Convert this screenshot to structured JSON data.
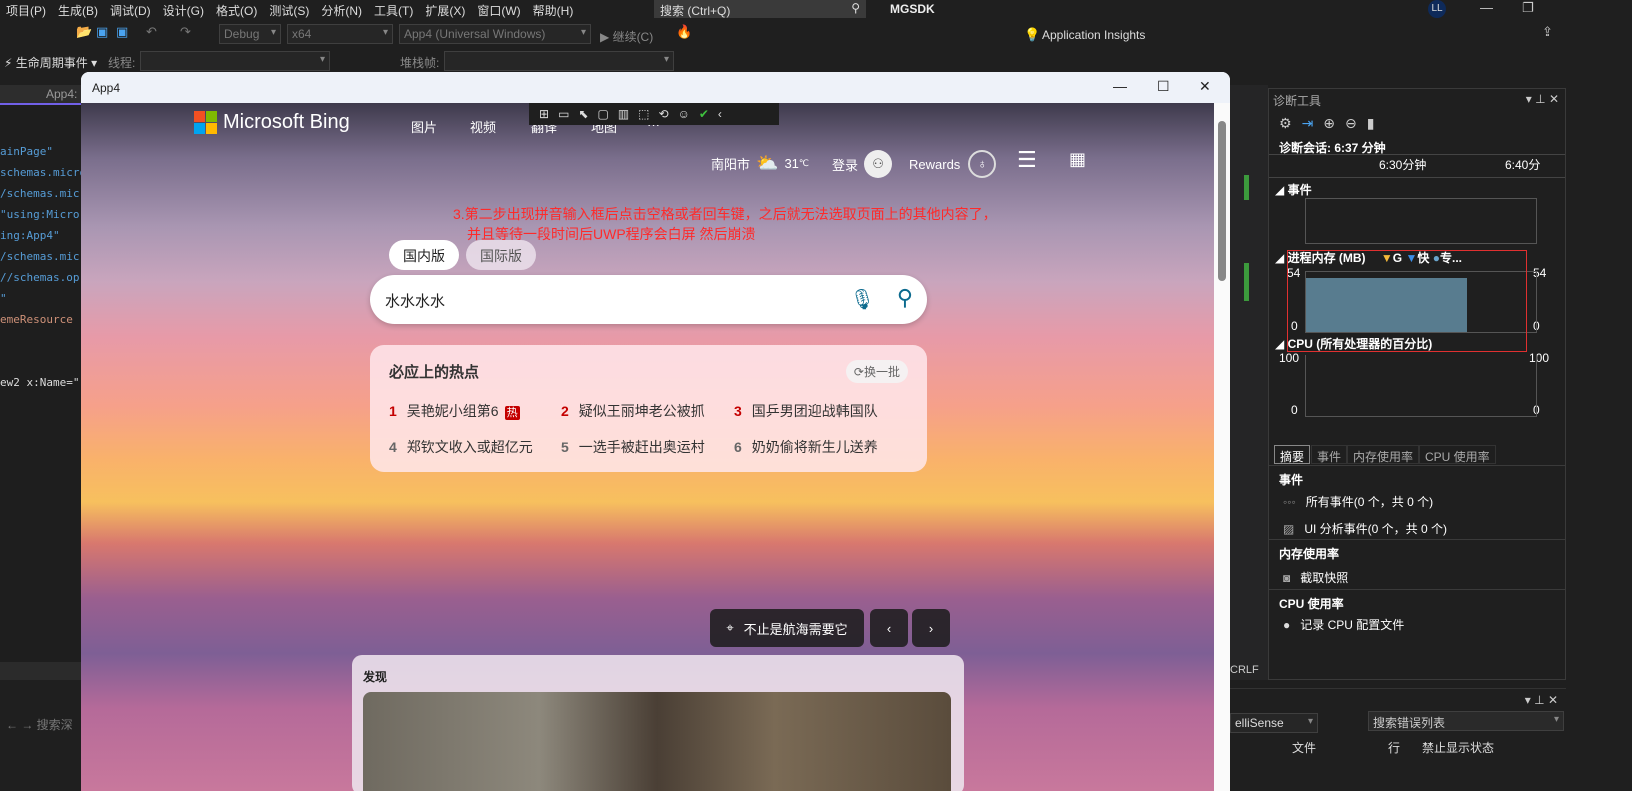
{
  "menu": [
    "项目(P)",
    "生成(B)",
    "调试(D)",
    "设计(G)",
    "格式(O)",
    "测试(S)",
    "分析(N)",
    "工具(T)",
    "扩展(X)",
    "窗口(W)",
    "帮助(H)"
  ],
  "search_placeholder": "搜索 (Ctrl+Q)",
  "project_name": "MGSDK",
  "user_initials": "LL",
  "toolbar": {
    "config": "Debug",
    "platform": "x64",
    "startup": "App4 (Universal Windows)",
    "continue": "继续(C)",
    "app_insights": "Application Insights"
  },
  "toolbar2": {
    "lifecycle": "生命周期事件",
    "thread_label": "线程:",
    "stack_label": "堆栈帧:"
  },
  "editor": {
    "tab": "App4:",
    "code": [
      "ainPage\"",
      "schemas.micro",
      "/schemas.mic",
      "\"using:Micro",
      "ing:App4\"",
      "/schemas.mic",
      "//schemas.op",
      "\"",
      "emeResource",
      "",
      "",
      "ew2 x:Name=\""
    ]
  },
  "app": {
    "title": "App4",
    "bing": {
      "logo": "Microsoft Bing",
      "nav": [
        "图片",
        "视频",
        "翻译",
        "地图",
        "···"
      ],
      "city": "南阳市",
      "temp": "31",
      "temp_unit": "℃",
      "login": "登录",
      "rewards": "Rewards",
      "note_line1": "3.第二步出现拼音输入框后点击空格或者回车键，之后就无法选取页面上的其他内容了，",
      "note_line2": "并且等待一段时间后UWP程序会白屏 然后崩溃",
      "tabs": [
        "国内版",
        "国际版"
      ],
      "search_value": "水水水水",
      "hot_title": "必应上的热点",
      "refresh": "换一批",
      "hot_badge": "热",
      "hot": [
        {
          "n": "1",
          "t": "吴艳妮小组第6"
        },
        {
          "n": "2",
          "t": "疑似王丽坤老公被抓"
        },
        {
          "n": "3",
          "t": "国乒男团迎战韩国队"
        },
        {
          "n": "4",
          "t": "郑钦文收入或超亿元"
        },
        {
          "n": "5",
          "t": "一选手被赶出奥运村"
        },
        {
          "n": "6",
          "t": "奶奶偷将新生儿送养"
        }
      ],
      "location_caption": "不止是航海需要它",
      "discover": "发现"
    }
  },
  "diag": {
    "title": "诊断工具",
    "session": "诊断会话: 6:37 分钟",
    "tick1": "6:30分钟",
    "tick2": "6:40分",
    "events": "事件",
    "memory": "进程内存 (MB)",
    "legend": [
      "G",
      "快",
      "专..."
    ],
    "mem_max": "54",
    "mem_min": "0",
    "mem_value_fraction": 0.9,
    "cpu": "CPU (所有处理器的百分比)",
    "cpu_max": "100",
    "cpu_min": "0",
    "tabs": [
      "摘要",
      "事件",
      "内存使用率",
      "CPU 使用率"
    ],
    "sec_events": "事件",
    "all_events": "所有事件(0 个，共 0 个)",
    "ui_events": "UI 分析事件(0 个，共 0 个)",
    "sec_memory": "内存使用率",
    "snapshot": "截取快照",
    "sec_cpu": "CPU 使用率",
    "record_cpu": "记录 CPU 配置文件"
  },
  "errlist": {
    "filter": "elliSense",
    "search": "搜索错误列表",
    "cols": [
      "文件",
      "行",
      "禁止显示状态"
    ]
  },
  "status": {
    "crlf": "CRLF",
    "find": "搜索深"
  }
}
